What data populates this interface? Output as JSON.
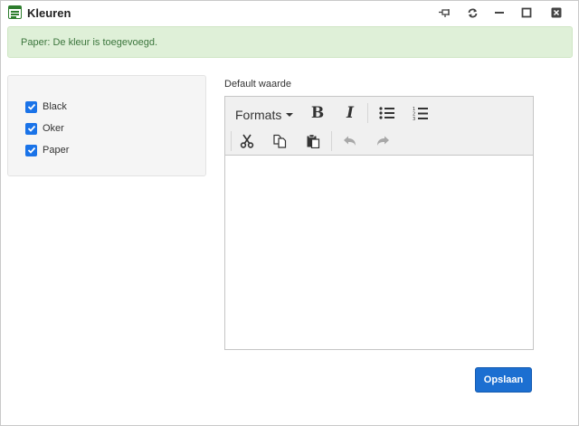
{
  "window": {
    "title": "Kleuren",
    "icon": "list-window-icon",
    "controls": [
      "pin-icon",
      "refresh-icon",
      "minimize-icon",
      "maximize-icon",
      "close-icon"
    ]
  },
  "alert": {
    "message": "Paper: De kleur is toegevoegd.",
    "color": "#3c763d",
    "background": "#dff0d8"
  },
  "colors_list": [
    {
      "label": "Black",
      "checked": true
    },
    {
      "label": "Oker",
      "checked": true
    },
    {
      "label": "Paper",
      "checked": true
    }
  ],
  "editor": {
    "label": "Default waarde",
    "formats_label": "Formats",
    "toolbar_row1": [
      "formats-dropdown",
      "bold-icon",
      "italic-icon",
      "bullet-list-icon",
      "numbered-list-icon"
    ],
    "toolbar_row2": [
      "cut-icon",
      "copy-icon",
      "paste-icon",
      "undo-icon",
      "redo-icon"
    ],
    "content": ""
  },
  "actions": {
    "save_label": "Opslaan",
    "accent_color": "#1c6fd1"
  }
}
